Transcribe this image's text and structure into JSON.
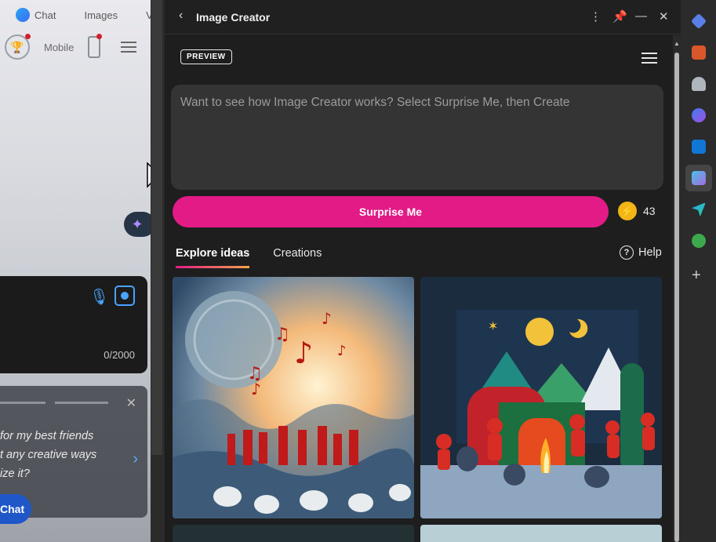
{
  "left_pane": {
    "nav": {
      "chat": "Chat",
      "images": "Images",
      "more": "V"
    },
    "mobile_label": "Mobile",
    "char_count": "0/2000",
    "suggestion_text": "for my best friends\nt any creative ways\nize it?",
    "chat_button": "Chat"
  },
  "panel": {
    "title": "Image Creator",
    "preview_badge": "PREVIEW",
    "prompt_placeholder": "Want to see how Image Creator works? Select Surprise Me, then Create",
    "surprise_button": "Surprise Me",
    "boost_count": "43",
    "tabs": [
      {
        "label": "Explore ideas",
        "active": true
      },
      {
        "label": "Creations",
        "active": false
      }
    ],
    "help_label": "Help"
  },
  "sidebar": {
    "icons": [
      "tag-icon",
      "toolbox-icon",
      "chess-icon",
      "copilot-icon",
      "outlook-icon",
      "image-creator-icon",
      "send-icon",
      "tree-icon"
    ]
  },
  "colors": {
    "accent": "#e21b86",
    "boost": "#f2b517",
    "panel_bg": "#1e1e1e"
  }
}
